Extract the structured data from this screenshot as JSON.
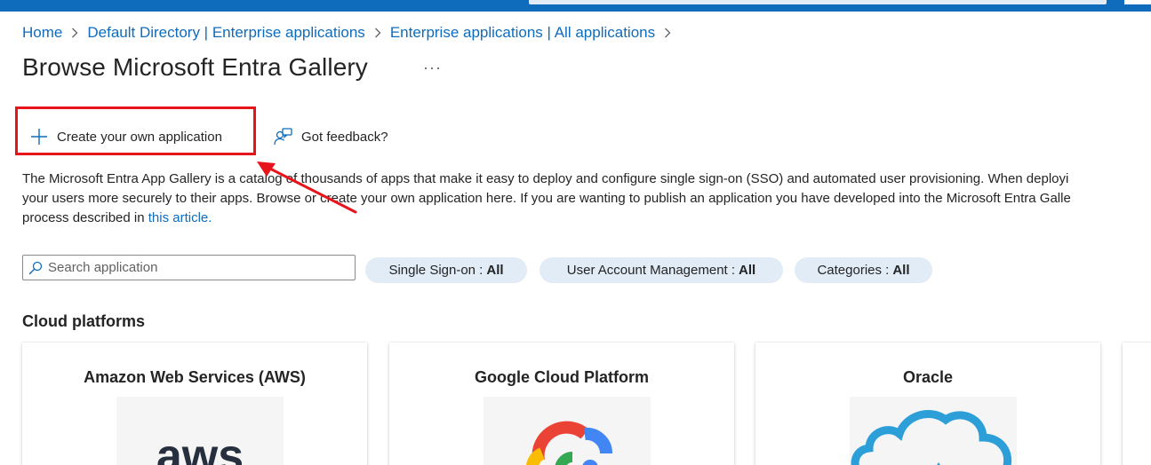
{
  "breadcrumb": {
    "items": [
      "Home",
      "Default Directory | Enterprise applications",
      "Enterprise applications | All applications"
    ]
  },
  "page": {
    "title": "Browse Microsoft Entra Gallery",
    "more_label": "···"
  },
  "commands": {
    "create_label": "Create your own application",
    "feedback_label": "Got feedback?"
  },
  "description": {
    "line1": "The Microsoft Entra App Gallery is a catalog of thousands of apps that make it easy to deploy and configure single sign-on (SSO) and automated user provisioning. When deployi",
    "line2": "your users more securely to their apps. Browse or create your own application here. If you are wanting to publish an application you have developed into the Microsoft Entra Galle",
    "line3_prefix": "process described in ",
    "link": "this article."
  },
  "search": {
    "placeholder": "Search application",
    "value": ""
  },
  "filters": {
    "sso": {
      "label": "Single Sign-on :",
      "value": "All"
    },
    "uam": {
      "label": "User Account Management :",
      "value": "All"
    },
    "categories": {
      "label": "Categories :",
      "value": "All"
    }
  },
  "section": {
    "title": "Cloud platforms"
  },
  "cards": [
    {
      "title": "Amazon Web Services (AWS)",
      "logo_text": "aws"
    },
    {
      "title": "Google Cloud Platform"
    },
    {
      "title": "Oracle"
    }
  ],
  "colors": {
    "accent": "#0f6cbd",
    "highlight": "#e8141c",
    "pill_bg": "#e1ecf7"
  }
}
